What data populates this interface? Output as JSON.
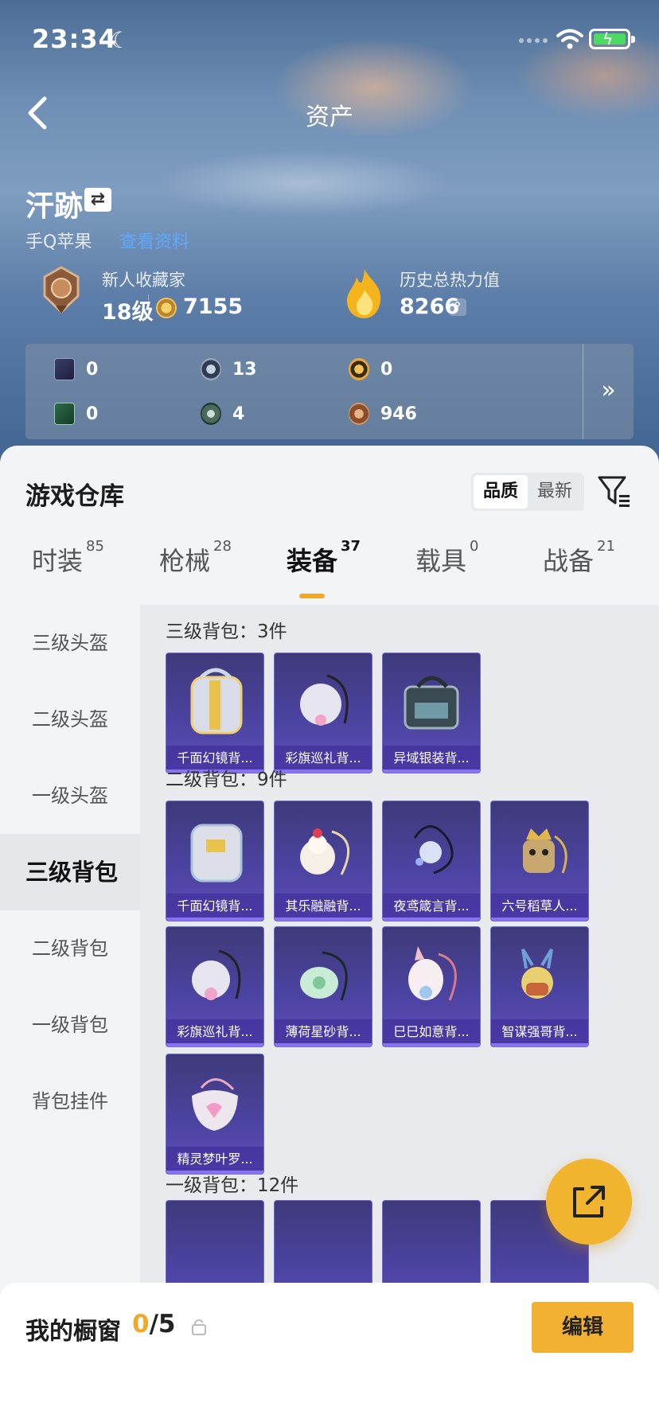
{
  "status": {
    "time": "23:34"
  },
  "header": {
    "title": "资产"
  },
  "profile": {
    "name": "汗跡",
    "platform": "手Q苹果",
    "platform_link": "查看资料",
    "collector": {
      "label": "新人收藏家",
      "level": "18级",
      "coins": "7155"
    },
    "heat": {
      "label": "历史总热力值",
      "value": "8266",
      "help": "?"
    }
  },
  "resources": [
    {
      "icon": "card-icon",
      "value": "0"
    },
    {
      "icon": "token-icon",
      "value": "13"
    },
    {
      "icon": "coupon-icon",
      "value": "0"
    },
    {
      "icon": "green-card-icon",
      "value": "0"
    },
    {
      "icon": "orb-icon",
      "value": "4"
    },
    {
      "icon": "bronze-coin-icon",
      "value": "946"
    }
  ],
  "resources_more": "»",
  "warehouse": {
    "title": "游戏仓库",
    "sort": [
      "品质",
      "最新"
    ],
    "tabs": [
      {
        "label": "时装",
        "count": "85"
      },
      {
        "label": "枪械",
        "count": "28"
      },
      {
        "label": "装备",
        "count": "37"
      },
      {
        "label": "载具",
        "count": "0"
      },
      {
        "label": "战备",
        "count": "21"
      }
    ],
    "categories": [
      "三级头盔",
      "二级头盔",
      "一级头盔",
      "三级背包",
      "二级背包",
      "一级背包",
      "背包挂件"
    ],
    "sections": [
      {
        "title": "三级背包：3件",
        "items": [
          "千面幻镜背...",
          "彩旗巡礼背...",
          "异域银装背..."
        ]
      },
      {
        "title": "二级背包：9件",
        "items": [
          "千面幻镜背...",
          "其乐融融背...",
          "夜鸢箴言背...",
          "六号稻草人...",
          "彩旗巡礼背...",
          "薄荷星砂背...",
          "巳巳如意背...",
          "智谋强哥背...",
          "精灵梦叶罗..."
        ]
      },
      {
        "title": "一级背包：12件",
        "items": []
      }
    ]
  },
  "showcase": {
    "label": "我的橱窗",
    "current": "0",
    "total": "/5",
    "edit": "编辑"
  },
  "colors": {
    "accent": "#f1a829",
    "item_bg": "#4b43a0",
    "hero": "#6f8fb6"
  }
}
